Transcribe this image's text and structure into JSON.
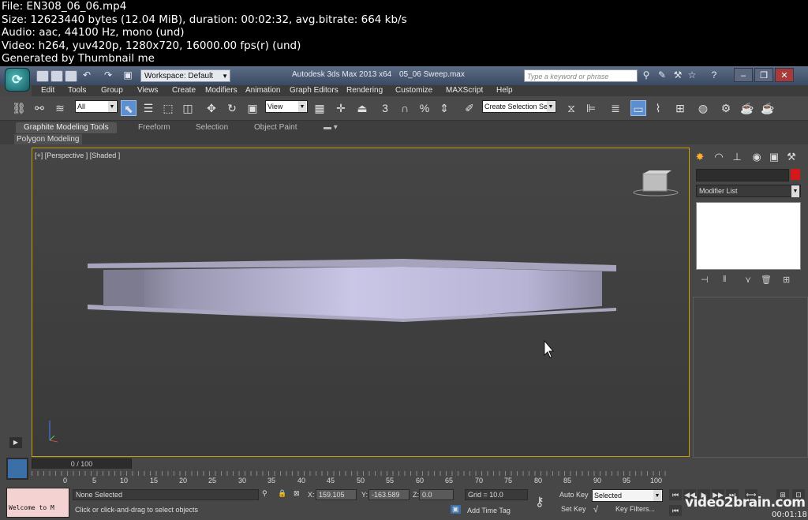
{
  "thumbnail_meta": {
    "file": "File: EN308_06_06.mp4",
    "size": "Size: 12623440 bytes (12.04 MiB), duration: 00:02:32, avg.bitrate: 664 kb/s",
    "audio": "Audio: aac, 44100 Hz, mono (und)",
    "video": "Video: h264, yuv420p, 1280x720, 16000.00 fps(r) (und)",
    "generated": "Generated by Thumbnail me"
  },
  "titlebar": {
    "workspace": "Workspace: Default",
    "app_title": "Autodesk 3ds Max  2013 x64",
    "file_name": "05_06 Sweep.max",
    "search_placeholder": "Type a keyword or phrase",
    "help_glyph": "?"
  },
  "menubar": {
    "items": [
      "Edit",
      "Tools",
      "Group",
      "Views",
      "Create",
      "Modifiers",
      "Animation",
      "Graph Editors",
      "Rendering",
      "Customize",
      "MAXScript",
      "Help"
    ]
  },
  "toolbar": {
    "selection_filter": "All",
    "reference_coord": "View",
    "named_selection": "Create Selection Se",
    "snap_3": "3",
    "snap_angle": "%"
  },
  "ribbon": {
    "tabs": [
      "Graphite Modeling Tools",
      "Freeform",
      "Selection",
      "Object Paint"
    ],
    "subpanel": "Polygon Modeling"
  },
  "viewport": {
    "label": "[+] [Perspective ] [Shaded ]"
  },
  "command_panel": {
    "modifier_list": "Modifier List"
  },
  "time_slider": {
    "frame_label": "0 / 100",
    "ticks": [
      "0",
      "5",
      "10",
      "15",
      "20",
      "25",
      "30",
      "35",
      "40",
      "45",
      "50",
      "55",
      "60",
      "65",
      "70",
      "75",
      "80",
      "85",
      "90",
      "95",
      "100"
    ]
  },
  "status": {
    "welcome": "Welcome to M",
    "selection": "None Selected",
    "prompt": "Click or click-and-drag to select objects",
    "x_label": "X:",
    "x_value": "159.105",
    "y_label": "Y:",
    "y_value": "-163.589",
    "z_label": "Z:",
    "z_value": "0.0",
    "grid": "Grid = 10.0",
    "add_time_tag": "Add Time Tag",
    "auto_key": "Auto Key",
    "key_mode": "Selected",
    "set_key": "Set Key",
    "key_filters": "Key Filters..."
  },
  "watermark": {
    "brand": "video2brain.com",
    "timecode": "00:01:18"
  }
}
